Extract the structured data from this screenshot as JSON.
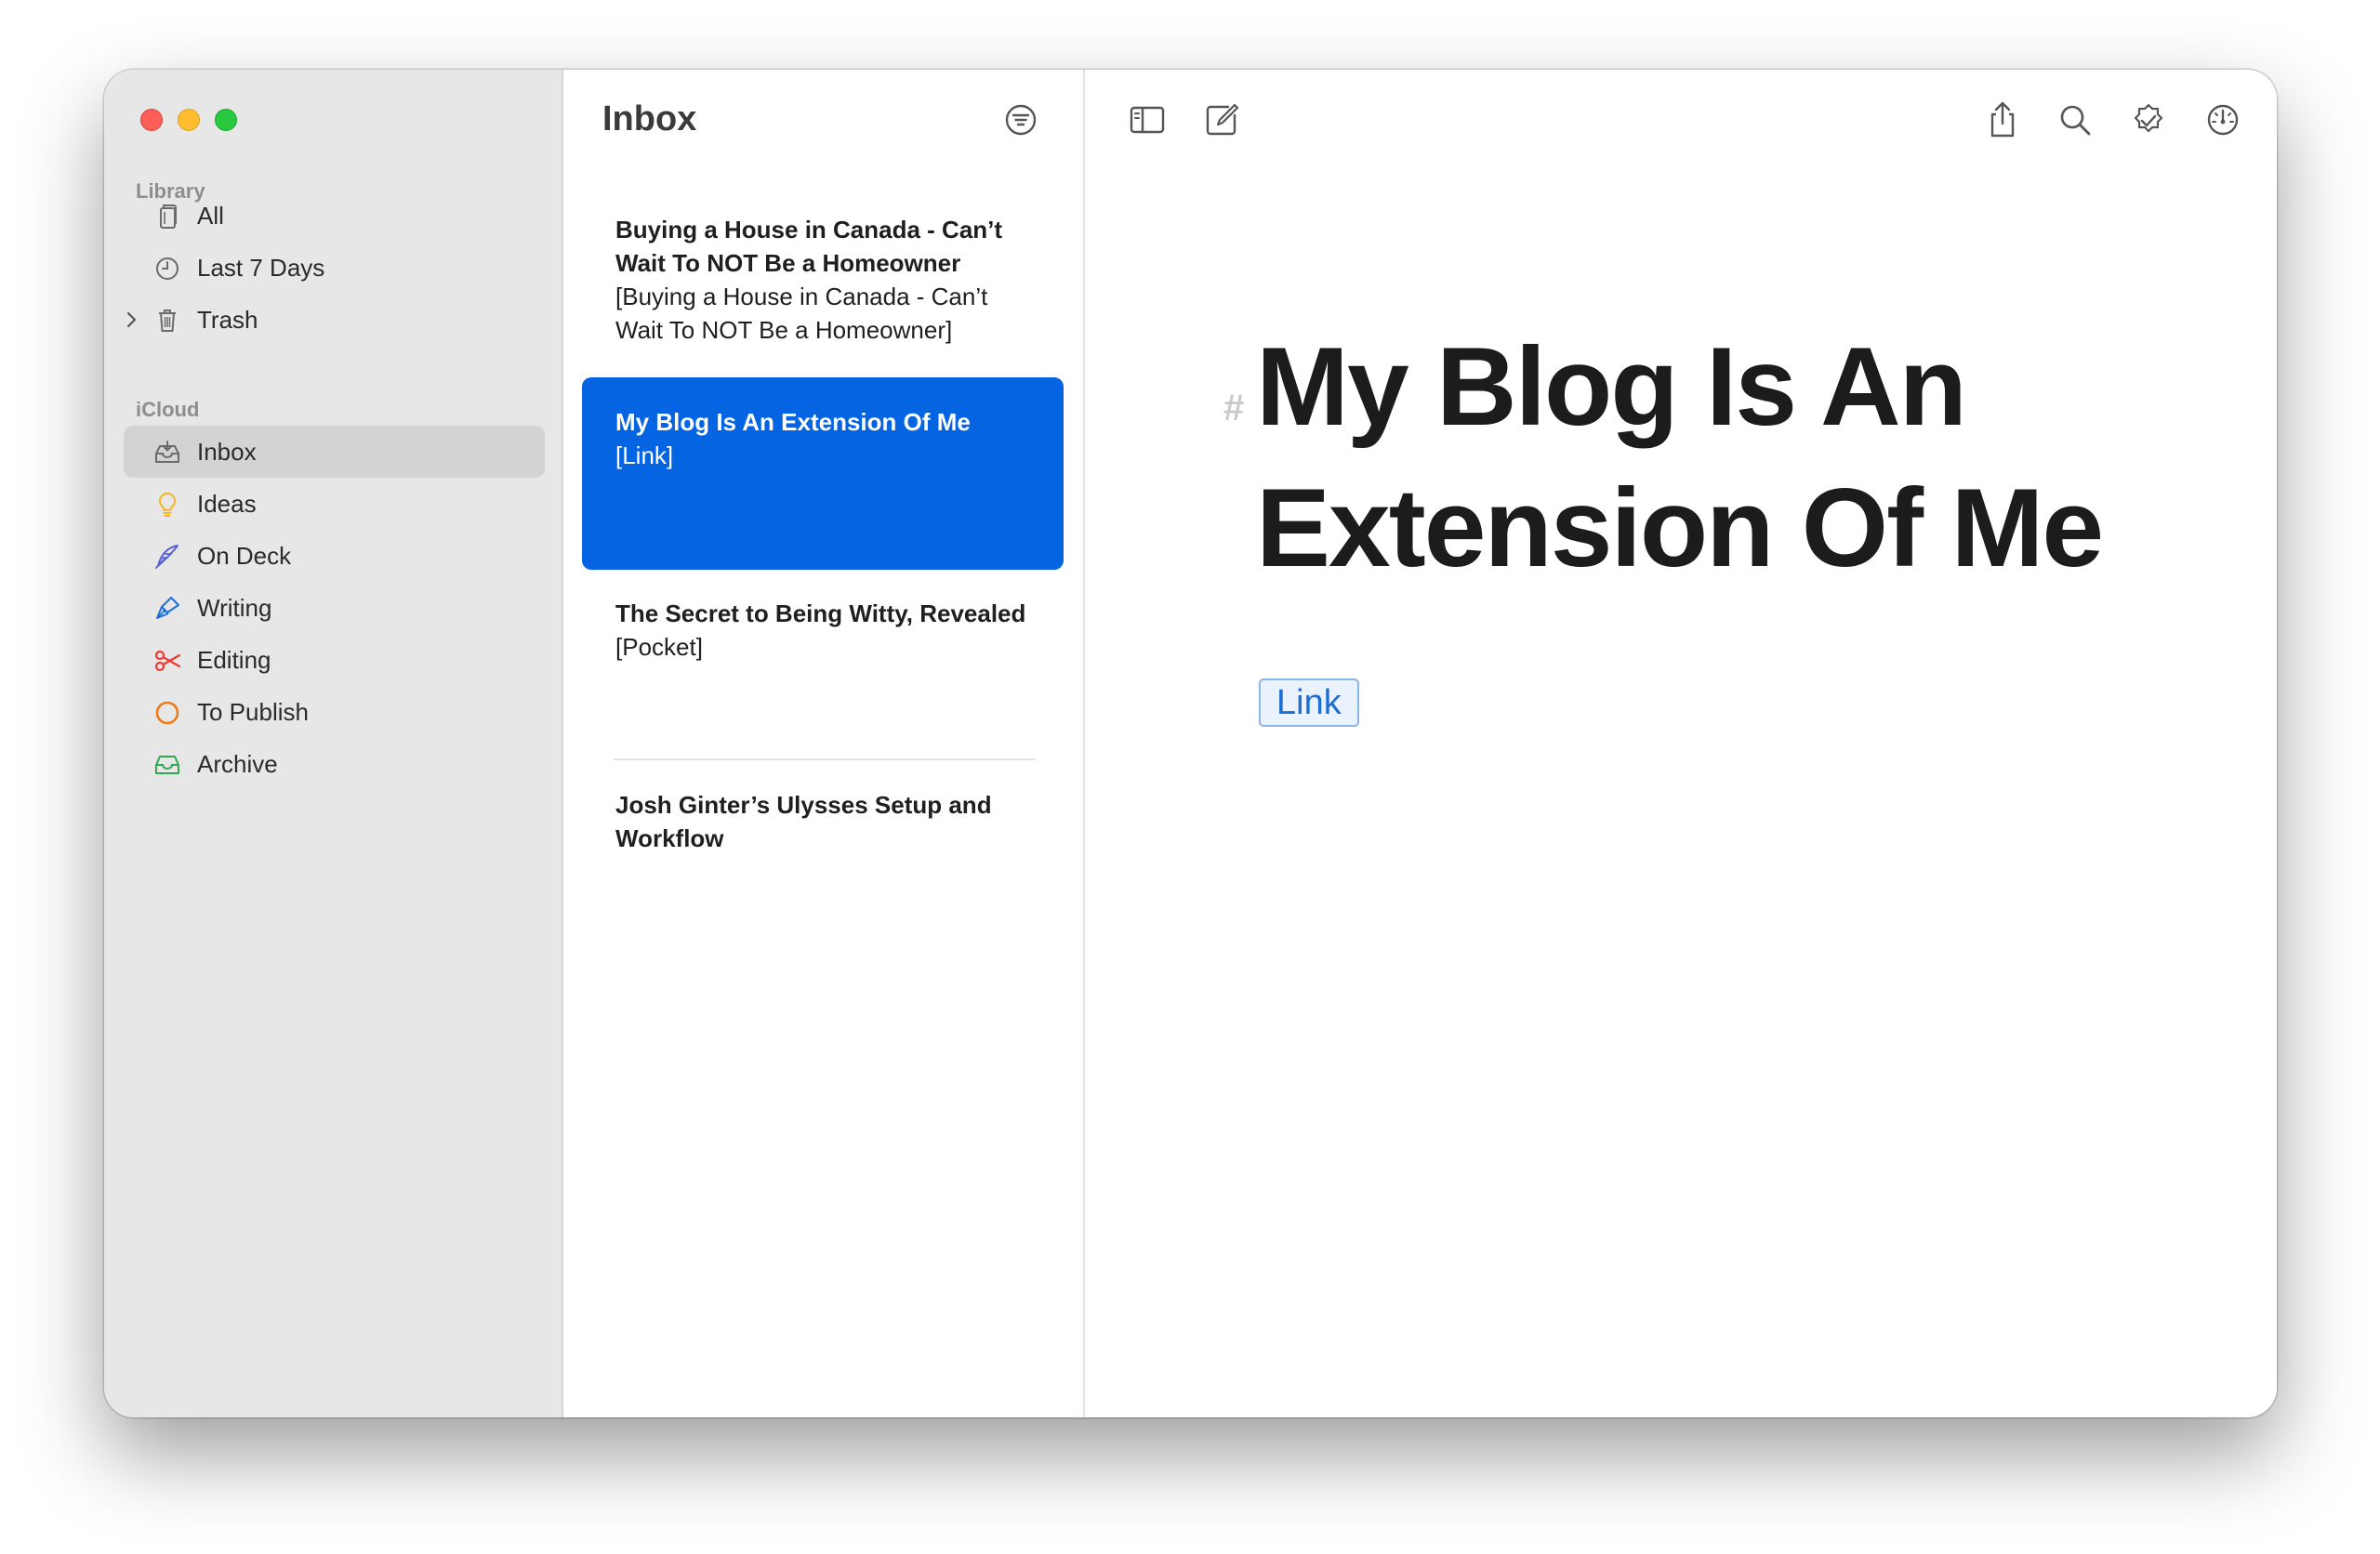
{
  "window": {
    "traffic_lights": [
      "close",
      "minimize",
      "zoom"
    ]
  },
  "sidebar": {
    "sections": [
      {
        "label": "Library",
        "items": [
          {
            "label": "All",
            "icon": "stack-icon",
            "color": "#6b6b6b"
          },
          {
            "label": "Last 7 Days",
            "icon": "clock-icon",
            "color": "#6b6b6b"
          },
          {
            "label": "Trash",
            "icon": "trash-icon",
            "color": "#6b6b6b",
            "collapsible": true
          }
        ]
      },
      {
        "label": "iCloud",
        "items": [
          {
            "label": "Inbox",
            "icon": "inbox-icon",
            "color": "#6b6b6b",
            "active": true
          },
          {
            "label": "Ideas",
            "icon": "lightbulb-icon",
            "color": "#f5b524"
          },
          {
            "label": "On Deck",
            "icon": "quill-icon",
            "color": "#5661d6"
          },
          {
            "label": "Writing",
            "icon": "pen-icon",
            "color": "#1e6fd8"
          },
          {
            "label": "Editing",
            "icon": "scissors-icon",
            "color": "#ee3b2f"
          },
          {
            "label": "To Publish",
            "icon": "circle-icon",
            "color": "#f07a1a"
          },
          {
            "label": "Archive",
            "icon": "archive-tray-icon",
            "color": "#2fa84f"
          }
        ]
      }
    ]
  },
  "list": {
    "title": "Inbox",
    "filter_icon": "filter-icon",
    "sheets": [
      {
        "title": "Buying a House in Canada - Can’t Wait To NOT Be a Homeowner",
        "preview": "[Buying a House in Canada - Can’t Wait To NOT Be a Homeowner]"
      },
      {
        "title": "My Blog Is An Extension Of Me",
        "preview": "[Link]",
        "selected": true
      },
      {
        "title": "The Secret to Being Witty, Revealed",
        "preview": "[Pocket]"
      },
      {
        "title": "Josh Ginter’s Ulysses Setup and Workflow",
        "preview": ""
      }
    ]
  },
  "toolbar": {
    "left": [
      "sidebar-toggle-icon",
      "compose-icon"
    ],
    "right": [
      "share-icon",
      "search-icon",
      "checklist-badge-icon",
      "dashboard-icon"
    ]
  },
  "editor": {
    "heading_marker": "#",
    "title": "My Blog Is An Extension Of Me",
    "link_label": "Link"
  },
  "colors": {
    "accent": "#0464e2",
    "sidebar_bg": "#e7e7e7",
    "link": "#1c6ed4"
  }
}
